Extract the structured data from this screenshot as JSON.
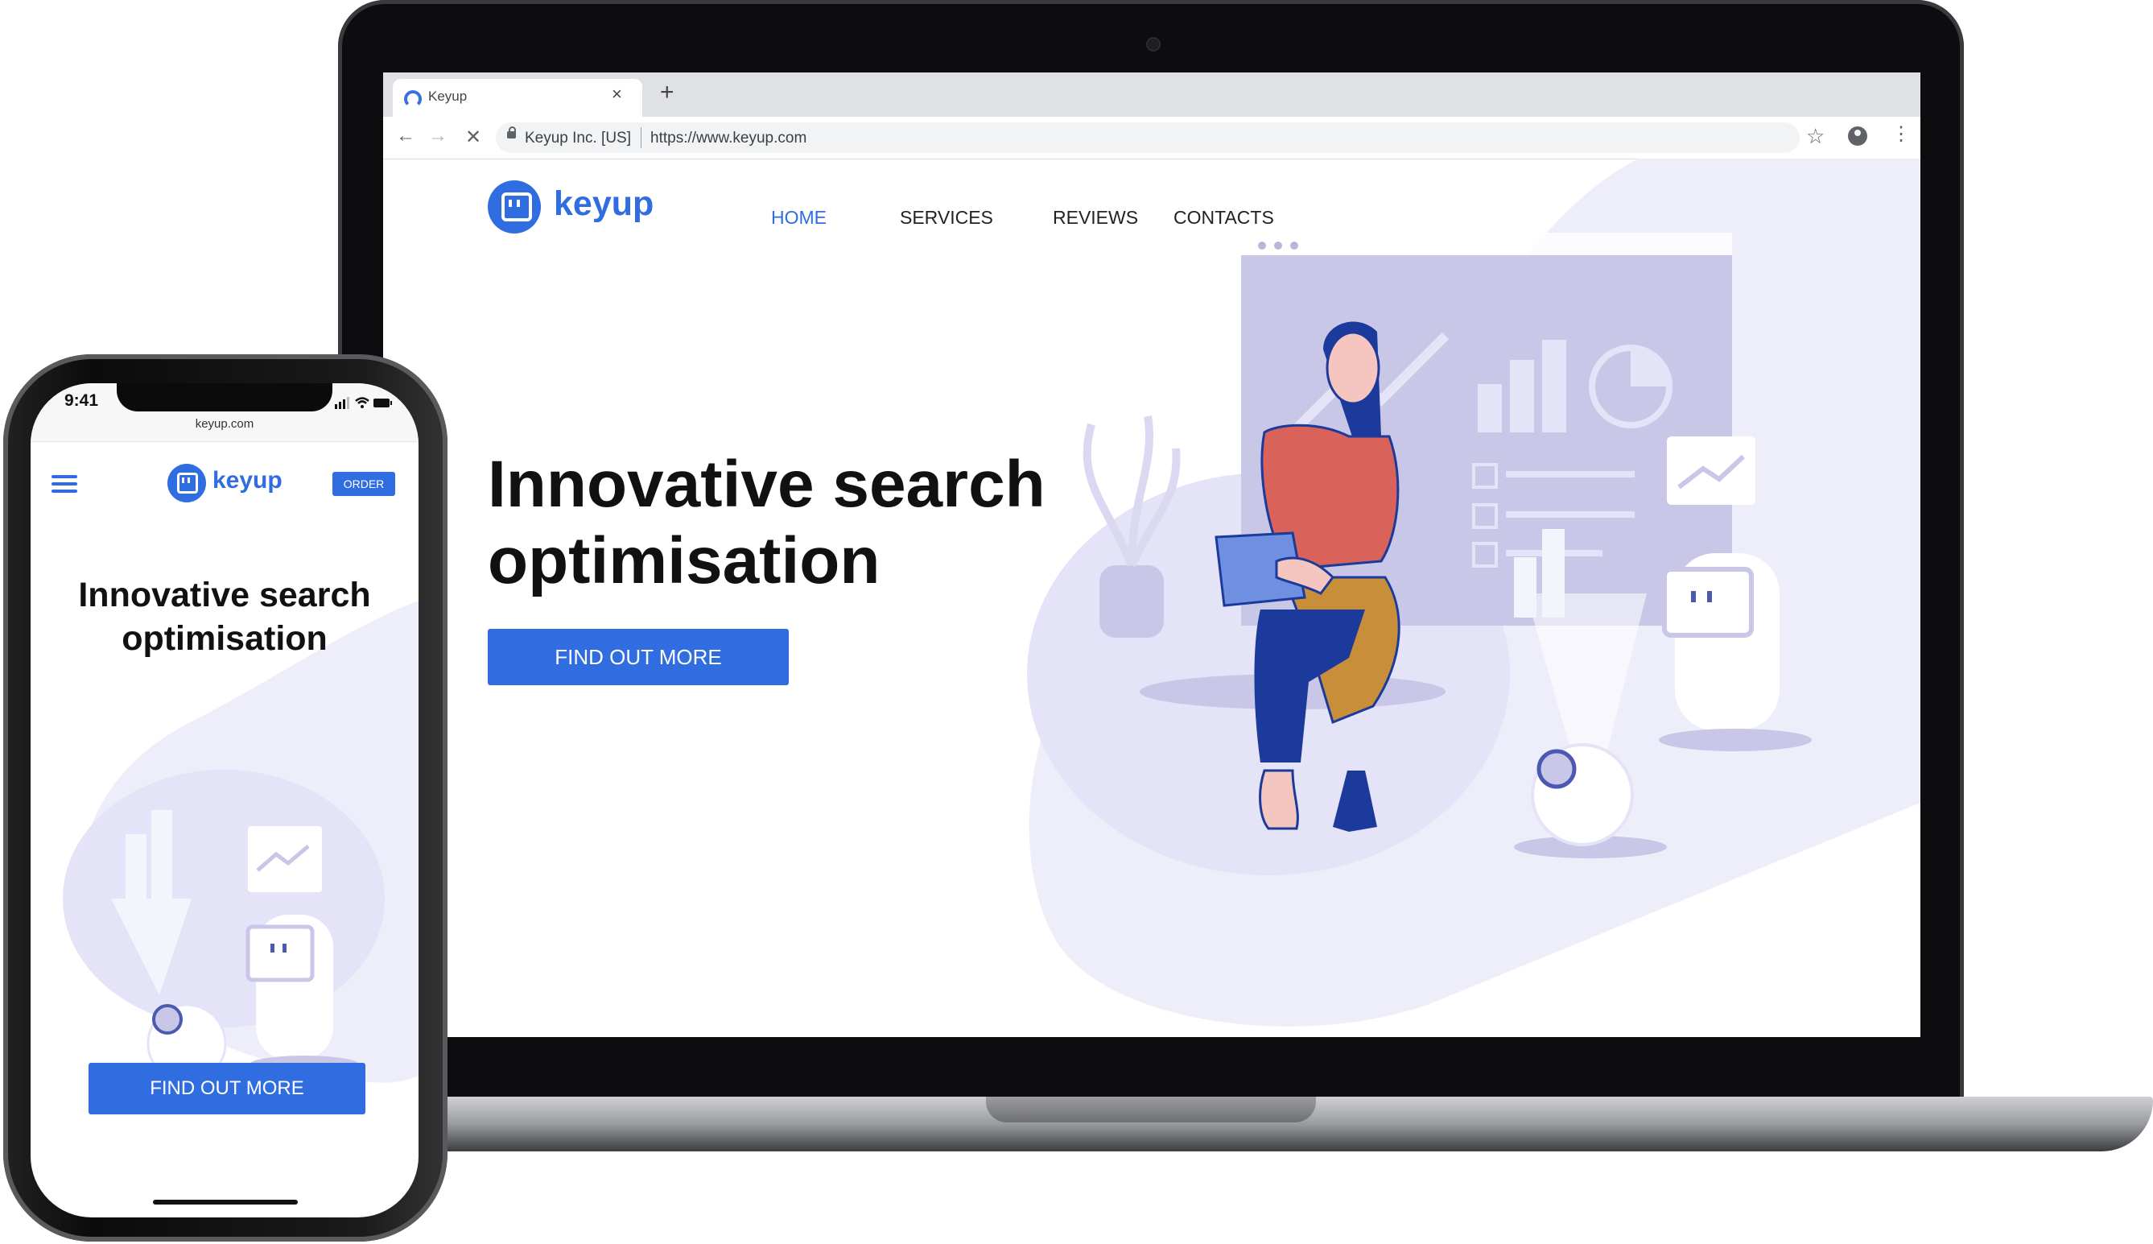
{
  "laptop": {
    "browser": {
      "tab_title": "Keyup",
      "tab_close": "×",
      "new_tab": "+",
      "back": "←",
      "forward": "→",
      "stop": "✕",
      "site_identity": "Keyup Inc. [US]",
      "url": "https://www.keyup.com",
      "star": "☆",
      "menu": "⋮"
    },
    "site": {
      "logo": "keyup",
      "nav": [
        "HOME",
        "SERVICES",
        "REVIEWS",
        "CONTACTS"
      ],
      "headline": "Innovative search optimisation",
      "cta": "FIND OUT MORE"
    }
  },
  "phone": {
    "time": "9:41",
    "url": "keyup.com",
    "logo": "keyup",
    "order": "ORDER",
    "headline": "Innovative search optimisation",
    "cta": "FIND OUT MORE"
  },
  "colors": {
    "brand_blue": "#2f6de0",
    "illustration_lavender": "#e4e3f7",
    "figure_red": "#d9635a",
    "figure_navy": "#1b3a9c",
    "figure_mustard": "#c98e3a"
  },
  "icons": [
    "tab-loading-icon",
    "back-arrow-icon",
    "forward-arrow-icon",
    "stop-icon",
    "lock-icon",
    "star-icon",
    "account-icon",
    "menu-dots-icon",
    "keyup-logo-icon",
    "hamburger-menu-icon",
    "signal-icon",
    "wifi-icon",
    "battery-icon"
  ]
}
